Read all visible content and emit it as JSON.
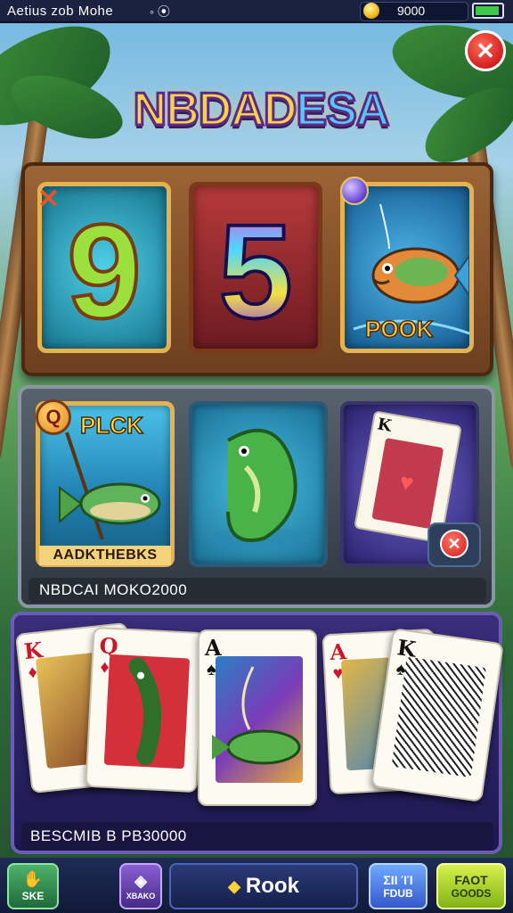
{
  "status_bar": {
    "title": "Aetius zob Mohe",
    "icon": "broadcast-icon",
    "coin_value": "9000",
    "battery": "battery-icon"
  },
  "game": {
    "logo": "NBDADESA",
    "close_icon": "close-icon"
  },
  "reels": {
    "symbols": [
      "9",
      "5",
      "fish"
    ],
    "pook_label": "POOK"
  },
  "middle_cards": {
    "plck_label": "PLCK",
    "card_1_banner": "AADKTHEBKS",
    "caption": "NBDCAI MOKO2000"
  },
  "hand": {
    "cards": [
      {
        "rank": "K",
        "suit": "♦",
        "color": "#c8192b"
      },
      {
        "rank": "Q",
        "suit": "♦",
        "color": "#c8192b"
      },
      {
        "rank": "A",
        "suit": "♠",
        "color": "#111111"
      },
      {
        "rank": "A",
        "suit": "♥",
        "color": "#c8192b"
      },
      {
        "rank": "K",
        "suit": "♠",
        "color": "#111111"
      }
    ],
    "caption": "BESCMIB B PB30000"
  },
  "nav": {
    "ske": "SKE",
    "store": "XBAKO",
    "rook": "Rook",
    "fd_top": "ΣΙΙ ΊΊ",
    "fd_bottom": "FDUB",
    "goods_top": "FAOT",
    "goods_bottom": "GOODS"
  }
}
